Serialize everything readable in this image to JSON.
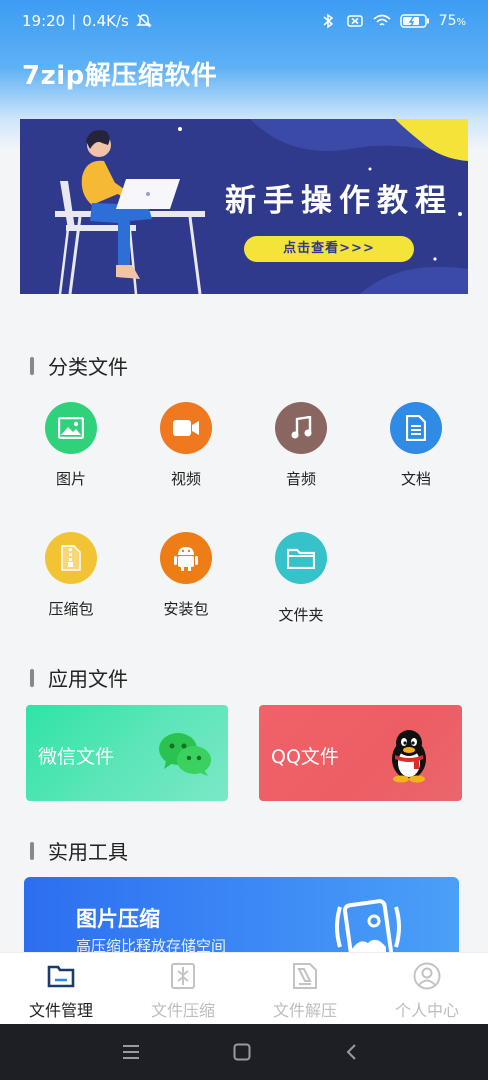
{
  "status_bar": {
    "time": "19:20",
    "speed": "0.4K/s",
    "battery": "75"
  },
  "app": {
    "title": "7zip解压缩软件"
  },
  "banner": {
    "title": "新手操作教程",
    "button": "点击查看>>>"
  },
  "sections": {
    "categories": "分类文件",
    "apps": "应用文件",
    "tools": "实用工具"
  },
  "categories": [
    {
      "label": "图片",
      "icon": "image-icon",
      "color": "#2fd27b"
    },
    {
      "label": "视频",
      "icon": "video-icon",
      "color": "#f0781f"
    },
    {
      "label": "音频",
      "icon": "music-icon",
      "color": "#8a6660"
    },
    {
      "label": "文档",
      "icon": "document-icon",
      "color": "#2f8be6"
    },
    {
      "label": "压缩包",
      "icon": "zip-icon",
      "color": "#f2c332"
    },
    {
      "label": "安装包",
      "icon": "android-icon",
      "color": "#ee7d16"
    },
    {
      "label": "文件夹",
      "icon": "folder-icon",
      "color": "#35c3c9"
    }
  ],
  "app_cards": {
    "wechat": "微信文件",
    "qq": "QQ文件"
  },
  "tool": {
    "title": "图片压缩",
    "subtitle": "高压缩比释放存储空间"
  },
  "bottom_nav": [
    {
      "label": "文件管理",
      "active": true
    },
    {
      "label": "文件压缩",
      "active": false
    },
    {
      "label": "文件解压",
      "active": false
    },
    {
      "label": "个人中心",
      "active": false
    }
  ]
}
